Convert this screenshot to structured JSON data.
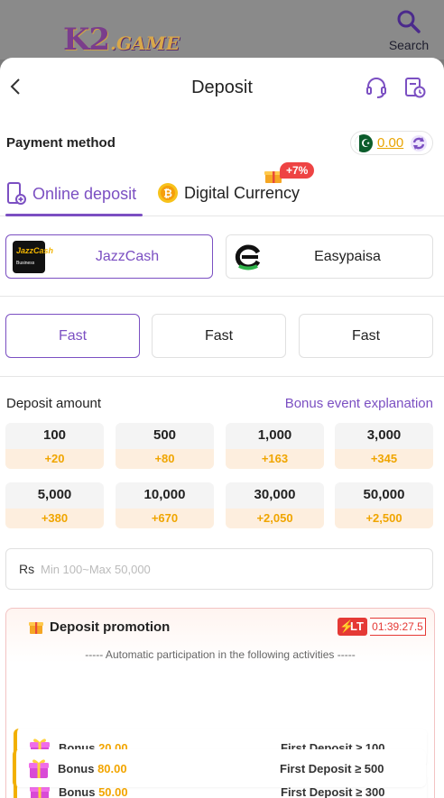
{
  "app": {
    "logo_text": "K2",
    "logo_sub": ".GAME",
    "search_label": "Search"
  },
  "header": {
    "title": "Deposit"
  },
  "payment": {
    "label": "Payment method",
    "balance": "0.00"
  },
  "tabs": [
    {
      "label": "Online deposit",
      "active": true
    },
    {
      "label": "Digital Currency",
      "badge": "+7%"
    }
  ],
  "methods": [
    {
      "label": "JazzCash",
      "logo_text": "JazzCash",
      "logo_sub": "Business",
      "active": true
    },
    {
      "label": "Easypaisa"
    }
  ],
  "channels": [
    {
      "label": "Fast",
      "active": true
    },
    {
      "label": "Fast"
    },
    {
      "label": "Fast"
    }
  ],
  "amount": {
    "label": "Deposit amount",
    "bonus_link": "Bonus event explanation",
    "options": [
      {
        "value": "100",
        "bonus": "+20"
      },
      {
        "value": "500",
        "bonus": "+80"
      },
      {
        "value": "1,000",
        "bonus": "+163"
      },
      {
        "value": "3,000",
        "bonus": "+345"
      },
      {
        "value": "5,000",
        "bonus": "+380"
      },
      {
        "value": "10,000",
        "bonus": "+670"
      },
      {
        "value": "30,000",
        "bonus": "+2,050"
      },
      {
        "value": "50,000",
        "bonus": "+2,500"
      }
    ],
    "currency": "Rs",
    "placeholder": "Min 100~Max 50,000"
  },
  "promotion": {
    "title": "Deposit promotion",
    "lt_label": "LT",
    "countdown": "01:39:27.5",
    "subtitle": "----- Automatic participation in the following activities -----",
    "items": [
      {
        "label": "Bonus",
        "amount": "20.00",
        "requirement": "First Deposit ≥ 100"
      },
      {
        "label": "Bonus",
        "amount": "50.00",
        "requirement": "First Deposit ≥ 300"
      },
      {
        "label": "Bonus",
        "amount": "80.00",
        "requirement": "First Deposit ≥ 500"
      }
    ]
  },
  "colors": {
    "accent": "#7b4fc2",
    "gold": "#f2a500",
    "red": "#e53935"
  },
  "icons": [
    "search-icon",
    "back-icon",
    "support-icon",
    "history-icon",
    "flag-icon",
    "refresh-icon",
    "phone-deposit-icon",
    "bitcoin-icon",
    "gift-icon"
  ]
}
